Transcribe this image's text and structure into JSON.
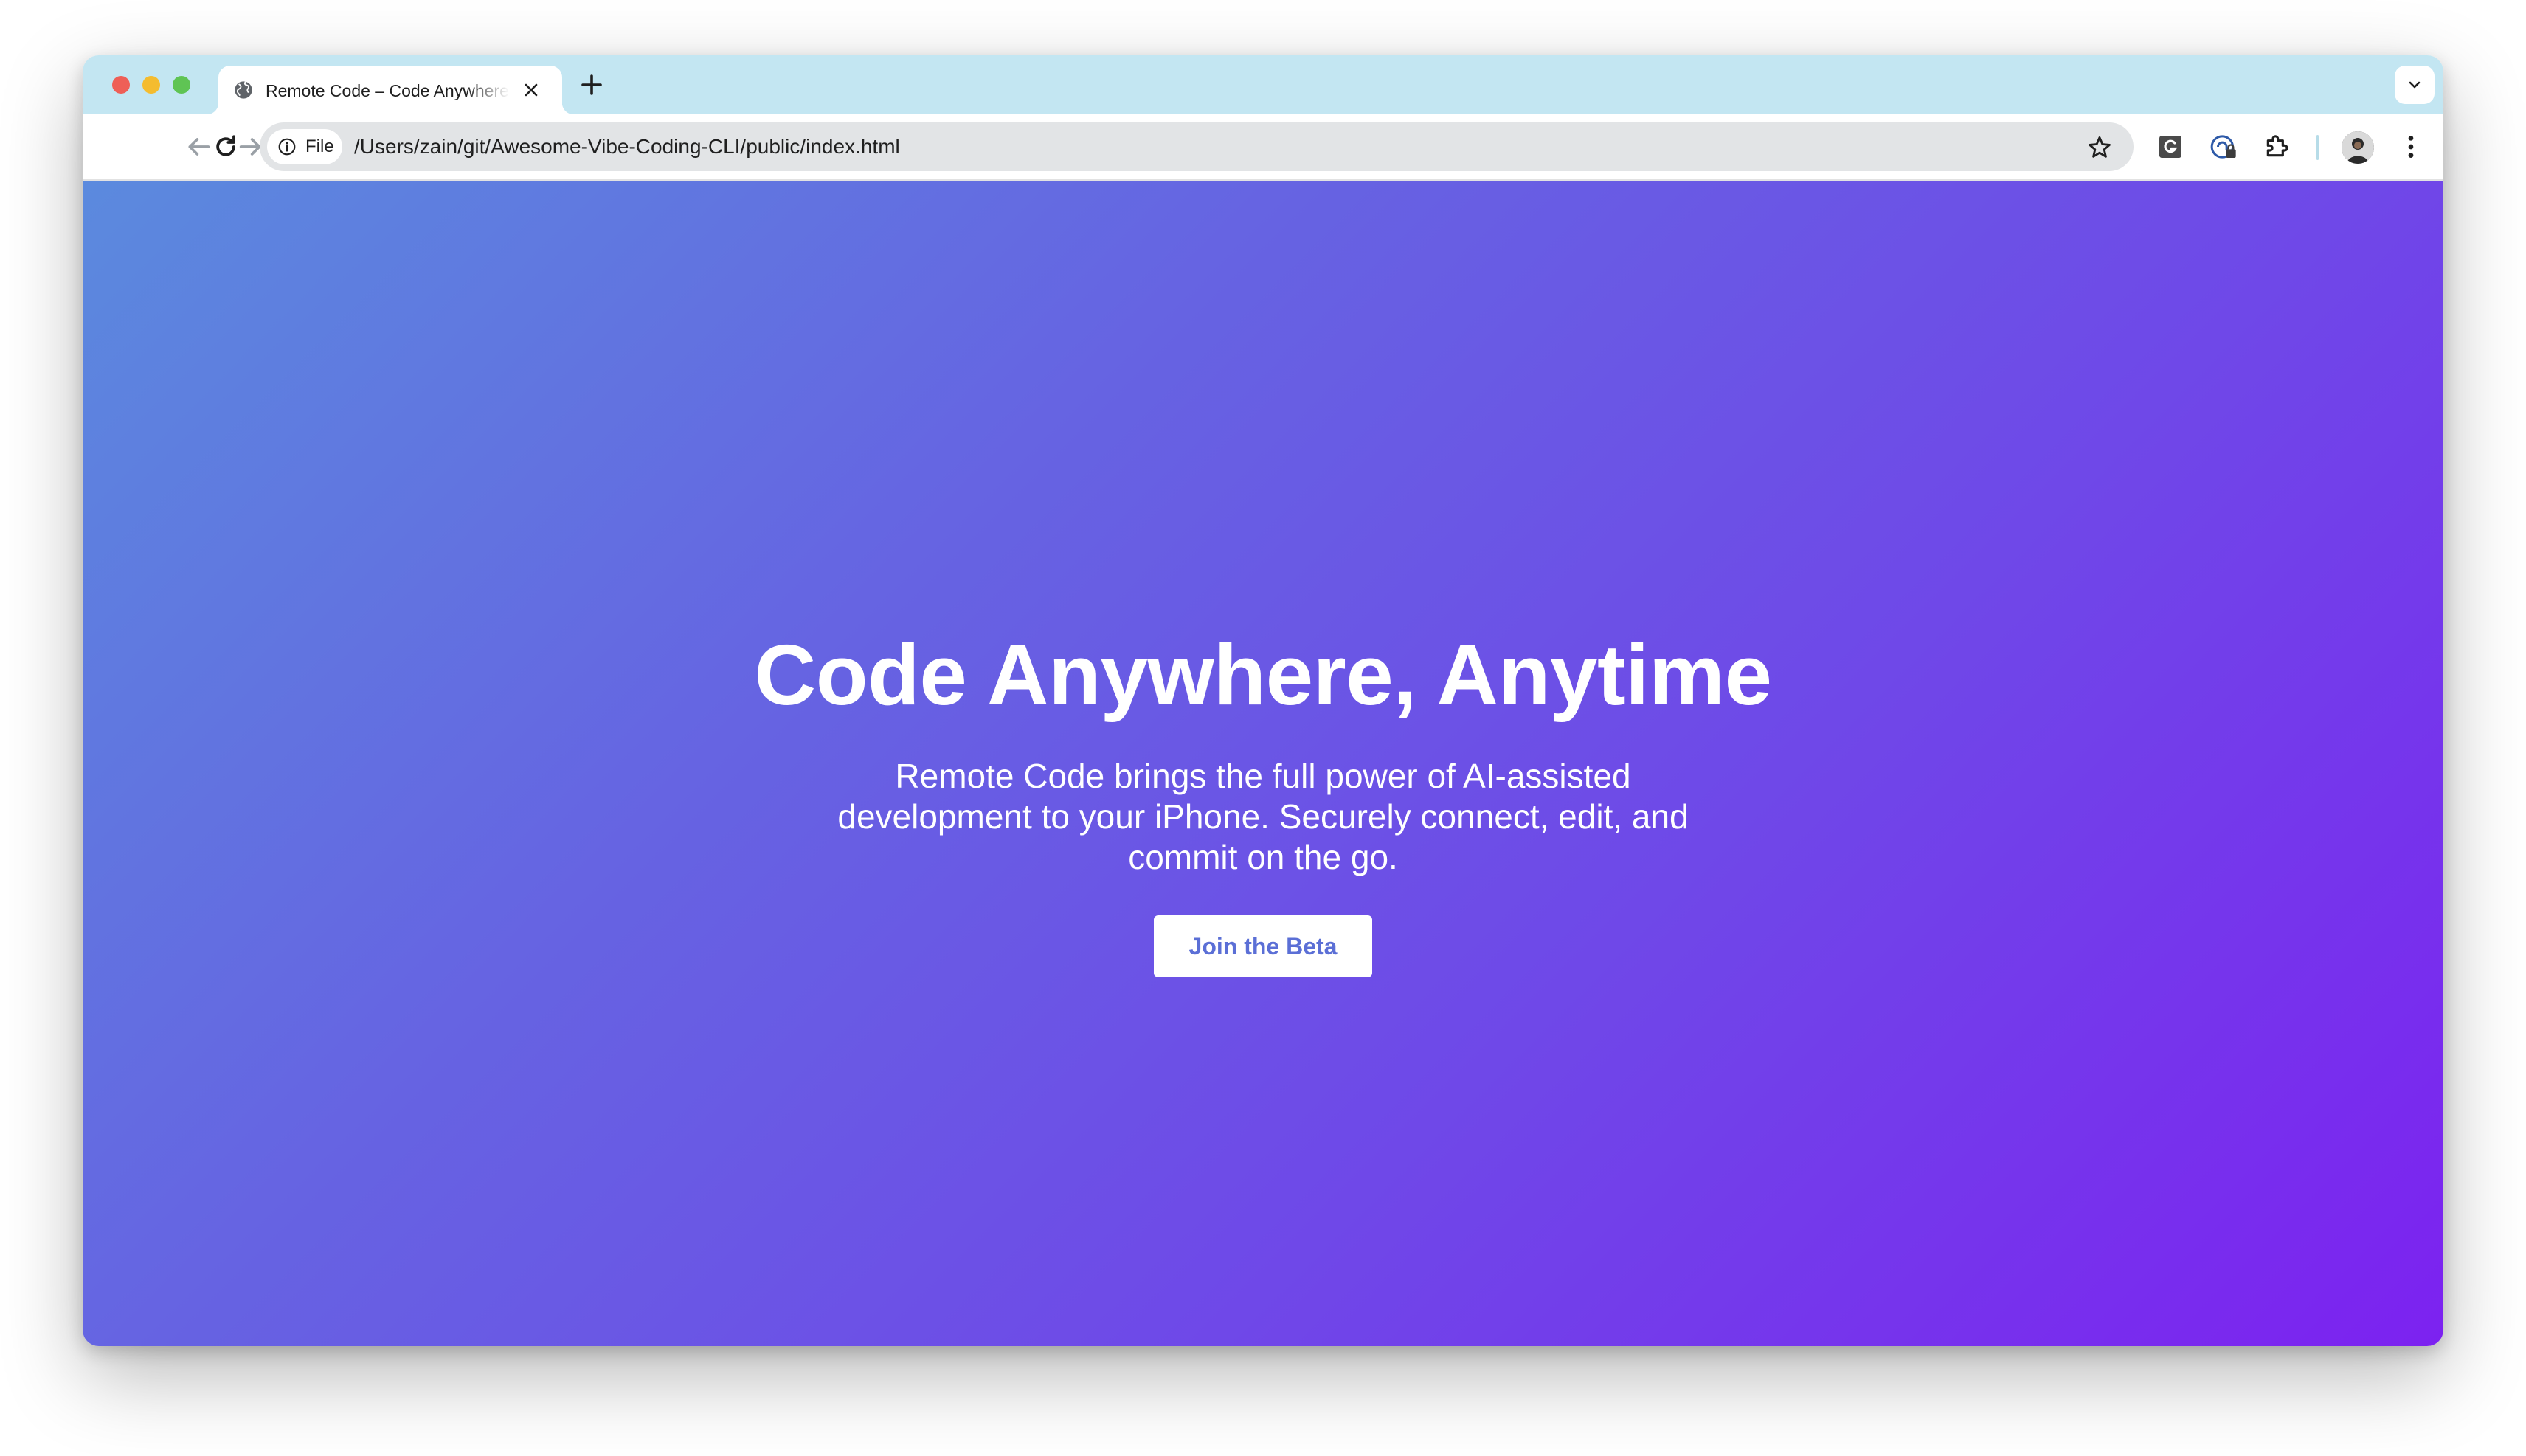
{
  "browser": {
    "tab": {
      "title": "Remote Code – Code Anywhere, Anytime",
      "icon": "globe-icon"
    },
    "toolbar": {
      "site_chip_label": "File",
      "url": "/Users/zain/git/Awesome-Vibe-Coding-CLI/public/index.html"
    },
    "extensions": [
      "grammarly-icon",
      "password-manager-icon",
      "extensions-puzzle-icon"
    ]
  },
  "page": {
    "hero": {
      "title": "Code Anywhere, Anytime",
      "subtitle": "Remote Code brings the full power of AI-assisted development to your iPhone. Securely connect, edit, and commit on the go.",
      "cta_label": "Join the Beta"
    }
  },
  "colors": {
    "gradient_start": "#5b8ade",
    "gradient_end": "#7c22f0",
    "cta_text": "#5b6fd6",
    "tabstrip": "#c3e6f2"
  }
}
